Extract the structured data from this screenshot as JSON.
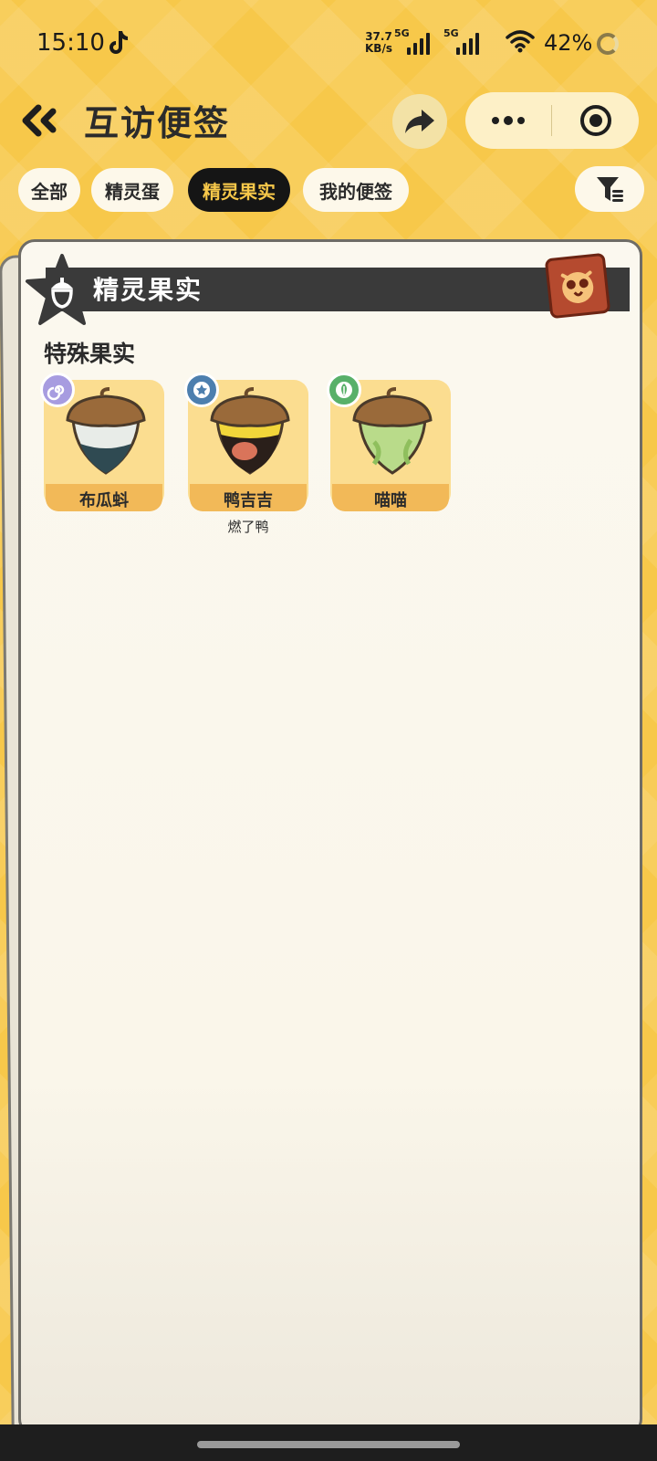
{
  "status_bar": {
    "time": "15:10",
    "net_speed_value": "37.7",
    "net_speed_unit": "KB/s",
    "signal1_label": "5G",
    "signal2_label": "5G",
    "battery": "42%",
    "icons": [
      "tiktok-icon",
      "wifi-icon",
      "battery-ring-icon"
    ]
  },
  "header": {
    "title": "互访便签",
    "icons": [
      "back-double-chevron-icon",
      "share-arrow-icon",
      "more-dots-icon",
      "close-target-icon"
    ]
  },
  "tabs": [
    {
      "label": "全部",
      "active": false
    },
    {
      "label": "精灵蛋",
      "active": false
    },
    {
      "label": "精灵果实",
      "active": true
    },
    {
      "label": "我的便签",
      "active": false
    }
  ],
  "filter_icon": "filter-funnel-icon",
  "card": {
    "section_title": "精灵果实",
    "section_icon": "acorn-star-icon",
    "badge_icon": "stamp-owl-icon",
    "sub_heading": "特殊果实",
    "fruits": [
      {
        "name": "布瓜蚪",
        "note": "",
        "type_icon": "spiral-type-icon",
        "type_color": "#a79ce0",
        "fruit_color": "#e8ece8",
        "fruit_bottom_color": "#2f4a52"
      },
      {
        "name": "鸭吉吉",
        "note": "燃了鸭",
        "type_icon": "star-type-icon",
        "type_color": "#4d7fae",
        "fruit_color": "#f2d63a",
        "fruit_bottom_color": "#2a1f1a"
      },
      {
        "name": "喵喵",
        "note": "",
        "type_icon": "leaf-type-icon",
        "type_color": "#58b069",
        "fruit_color": "#b9db8a",
        "fruit_bottom_color": "#8fbf5d"
      }
    ]
  },
  "colors": {
    "background": "#f7c84a",
    "active_tab": "#151515",
    "active_tab_text": "#f7c84a",
    "banner": "#3a3a3a",
    "fruit_card": "#fbdd90"
  }
}
